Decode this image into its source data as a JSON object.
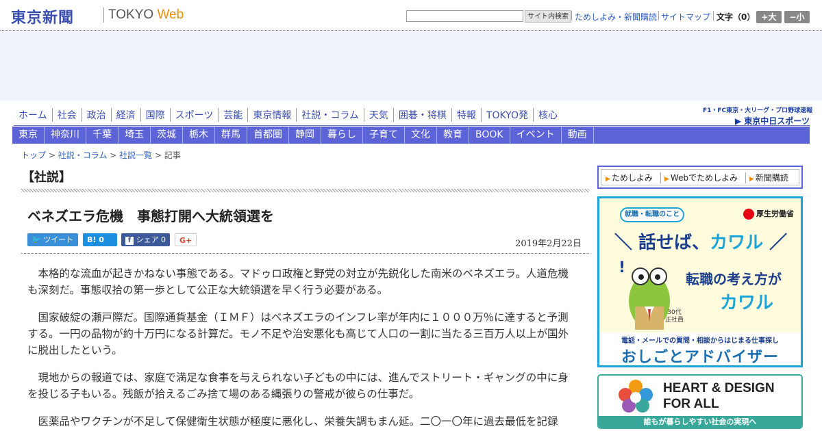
{
  "header": {
    "logo_jp": "東京新聞",
    "logo_en_1": "TOKYO ",
    "logo_en_2": "Web",
    "search_button": "サイト内検索",
    "links": [
      "ためしよみ・新聞購読",
      "サイトマップ"
    ],
    "font_label": "文字（0）",
    "font_plus": "+大",
    "font_minus": "−小"
  },
  "nav_primary": [
    "ホーム",
    "社会",
    "政治",
    "経済",
    "国際",
    "スポーツ",
    "芸能",
    "東京情報",
    "社説・コラム",
    "天気",
    "囲碁・将棋",
    "特報",
    "TOKYO発",
    "核心"
  ],
  "chunichi": {
    "line1": "F1・FC東京・大リーグ・プロ野球速報",
    "line2": "▶ 東京中日スポーツ"
  },
  "nav_secondary": [
    "東京",
    "神奈川",
    "千葉",
    "埼玉",
    "茨城",
    "栃木",
    "群馬",
    "首都圏",
    "静岡",
    "暮らし",
    "子育て",
    "文化",
    "教育",
    "BOOK",
    "イベント",
    "動画"
  ],
  "breadcrumb": {
    "items": [
      "トップ",
      "社説・コラム",
      "社説一覧"
    ],
    "sep": " > ",
    "current": "記事"
  },
  "article": {
    "section": "【社説】",
    "headline": "ベネズエラ危機　事態打開へ大統領選を",
    "share": {
      "tweet": "ツイート",
      "hatena": "B!  0",
      "facebook": "シェア  0",
      "gplus": "G+"
    },
    "date": "2019年2月22日",
    "paragraphs": [
      "本格的な流血が起きかねない事態である。マドゥロ政権と野党の対立が先鋭化した南米のベネズエラ。人道危機も深刻だ。事態収拾の第一歩として公正な大統領選を早く行う必要がある。",
      "国家破綻の瀬戸際だ。国際通貨基金（ＩＭＦ）はベネズエラのインフレ率が年内に１０００万％に達すると予測する。一円の品物が約十万円になる計算だ。モノ不足や治安悪化も高じて人口の一割に当たる三百万人以上が国外に脱出したという。",
      "現地からの報道では、家庭で満足な食事を与えられない子どもの中には、進んでストリート・ギャングの中に身を投じる子もいる。残飯が拾えるごみ捨て場のある縄張りの警戒が彼らの仕事だ。",
      "医薬品やワクチンが不足して保健衛生状態が極度に悪化し、栄養失調もまん延。二〇一〇年に過去最低を記録"
    ]
  },
  "sidebar": {
    "subscribe": [
      "ためしよみ",
      "Webでためしよみ",
      "新聞購読"
    ],
    "ad1": {
      "pill": "就職・転職のこと",
      "ministry": "厚生労働省",
      "big_1": "＼ 話せば、",
      "big_2": "カワル",
      "big_3": " ／",
      "q1": "転職の考え方が",
      "q2": "カワル",
      "age_1": "30代",
      "age_2": "正社員",
      "sub": "電話・メールでの質問・相談からはじまる仕事探し",
      "bottom": "おしごとアドバイザー"
    },
    "ad2": {
      "line1": "HEART & DESIGN",
      "line2": "FOR ALL",
      "foot": "誰もが暮らしやすい社会の実現へ"
    }
  },
  "colors": {
    "brand": "#3b4fb0",
    "nav_bar": "#5b63d6",
    "link": "#2d5dc0",
    "accent": "#f08c00",
    "twitter": "#3a8fd9",
    "hatena": "#1d8fe0",
    "facebook": "#3b5998"
  }
}
